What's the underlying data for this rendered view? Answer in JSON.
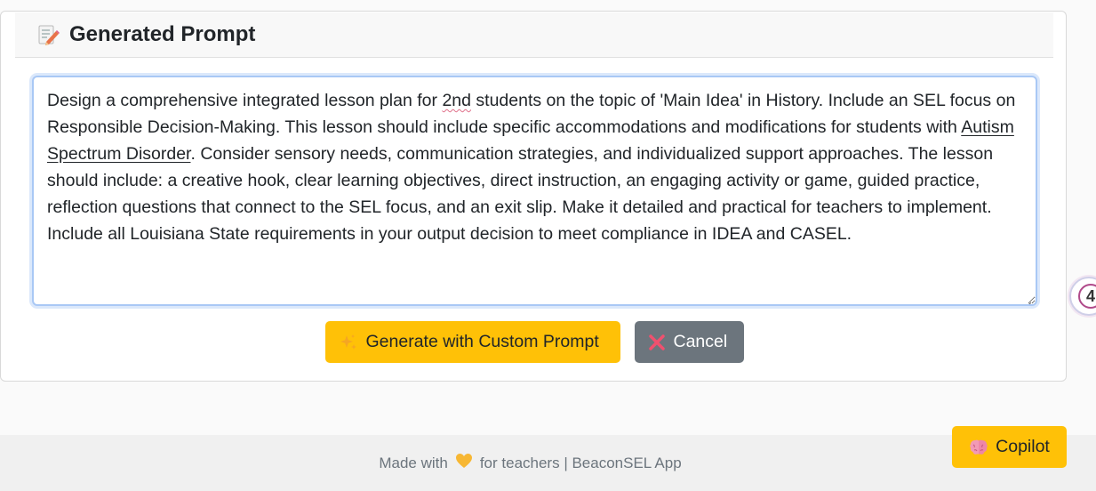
{
  "card": {
    "title": "Generated Prompt",
    "icon": "memo-icon"
  },
  "prompt": {
    "seg1": "Design a comprehensive integrated lesson plan for ",
    "grade": "2nd",
    "seg2": " students on the topic of 'Main Idea' in History. Include an SEL focus on Responsible Decision-Making. This lesson should include specific accommodations and modifications for students with ",
    "disability": "Autism Spectrum Disorder",
    "seg3": ". Consider sensory needs, communication strategies, and individualized support approaches. The lesson should include: a creative hook, clear learning objectives, direct instruction, an engaging activity or game, guided practice, reflection questions that connect to the SEL focus, and an exit slip. Make it detailed and practical for teachers to implement. Include all Louisiana State requirements in your output decision to meet compliance in IDEA and CASEL."
  },
  "buttons": {
    "generate_label": "Generate with Custom Prompt",
    "generate_icon": "sparkles-icon",
    "cancel_label": "Cancel",
    "cancel_icon": "cross-mark-icon"
  },
  "footer": {
    "prefix": "Made with",
    "heart_icon": "yellow-heart-icon",
    "suffix": "for teachers | BeaconSEL App"
  },
  "copilot": {
    "label": "Copilot",
    "icon": "brain-icon"
  },
  "edge_badge": {
    "count": "4"
  },
  "colors": {
    "accent_yellow": "#ffc107",
    "cancel_gray": "#6c757d",
    "focus_blue": "#a9c8f5"
  }
}
